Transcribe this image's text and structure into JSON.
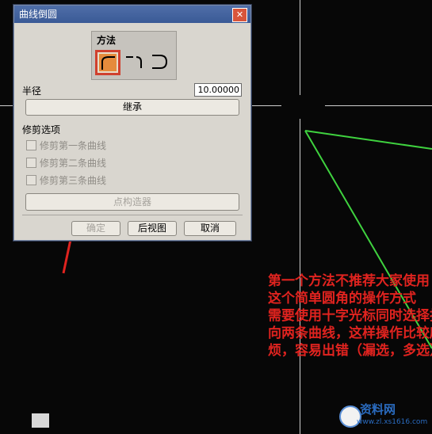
{
  "dialog": {
    "title": "曲线倒圆",
    "close_glyph": "✕",
    "method_label": "方法",
    "radius_label": "半径",
    "radius_value": "10.00000",
    "inherit_button": "继承",
    "trim_section": "修剪选项",
    "trim_options": [
      "修剪第一条曲线",
      "修剪第二条曲线",
      "修剪第三条曲线"
    ],
    "point_constructor_button": "点构造器",
    "ok_button": "确定",
    "back_button": "后视图",
    "cancel_button": "取消"
  },
  "annotation": {
    "lines": [
      "第一个方法不推荐大家使用",
      "这个简单圆角的操作方式",
      "需要使用十字光标同时选择指",
      "向两条曲线，这样操作比较麻",
      "烦，容易出错（漏选，多选）"
    ]
  },
  "watermark": {
    "title": "资料网",
    "url": "www.zl.xs1616.com"
  },
  "colors": {
    "annotation": "#e0231f",
    "curve": "#3fd23f",
    "background": "#070707"
  }
}
